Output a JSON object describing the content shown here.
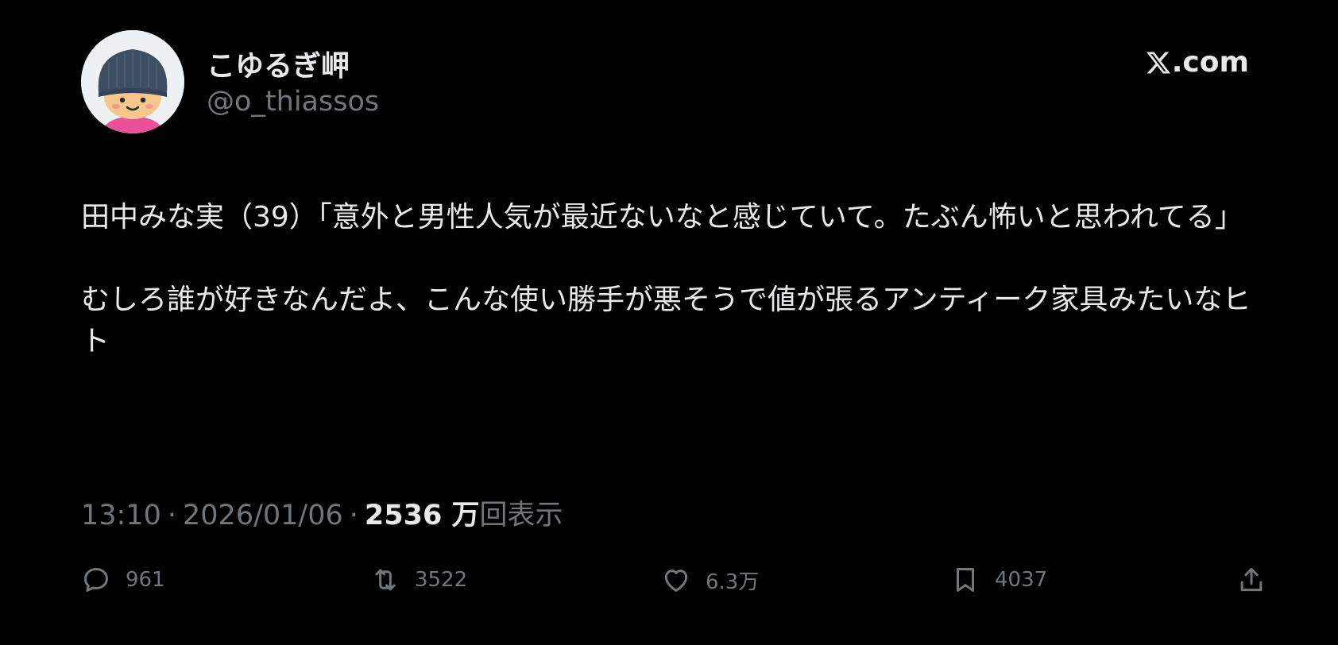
{
  "header": {
    "display_name": "こゆるぎ岬",
    "handle": "@o_thiassos",
    "brand": ".com"
  },
  "tweet": {
    "paragraphs": [
      "田中みな実（39）「意外と男性人気が最近ないなと感じていて。たぶん怖いと思われてる」",
      "むしろ誰が好きなんだよ、こんな使い勝手が悪そうで値が張るアンティーク家具みたいなヒト"
    ]
  },
  "meta": {
    "time": "13:10",
    "separator": "·",
    "date": "2026/01/06",
    "views_count": "2536 万",
    "views_label": "回表示"
  },
  "actions": {
    "replies": "961",
    "reposts": "3522",
    "likes": "6.3万",
    "bookmarks": "4037"
  },
  "icons": [
    "x-logo-icon",
    "reply-icon",
    "retweet-icon",
    "heart-icon",
    "bookmark-icon",
    "share-icon"
  ],
  "colors": {
    "background": "#000000",
    "text_primary": "#e7e9ea",
    "text_secondary": "#71767b"
  }
}
